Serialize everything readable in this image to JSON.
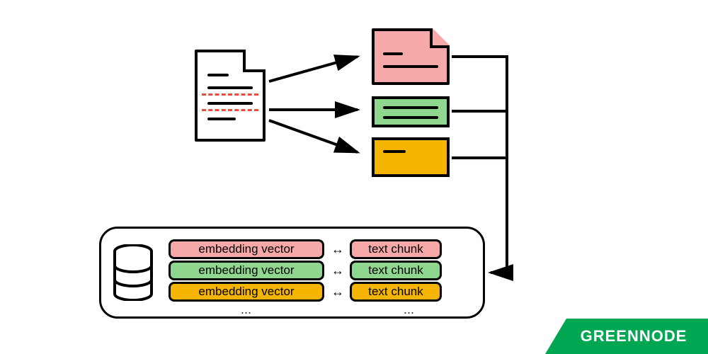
{
  "diagram": {
    "source": "document",
    "chunks": [
      {
        "color": "pink",
        "hex": "#f7a8a8"
      },
      {
        "color": "green",
        "hex": "#8fd68f"
      },
      {
        "color": "orange",
        "hex": "#f5b400"
      }
    ],
    "storage_rows": [
      {
        "embedding_label": "embedding vector",
        "chunk_label": "text chunk",
        "color": "pink"
      },
      {
        "embedding_label": "embedding vector",
        "chunk_label": "text chunk",
        "color": "green"
      },
      {
        "embedding_label": "embedding vector",
        "chunk_label": "text chunk",
        "color": "orange"
      }
    ],
    "ellipsis": "...",
    "bidirectional_symbol": "↔"
  },
  "brand": {
    "name": "GREENNODE"
  }
}
